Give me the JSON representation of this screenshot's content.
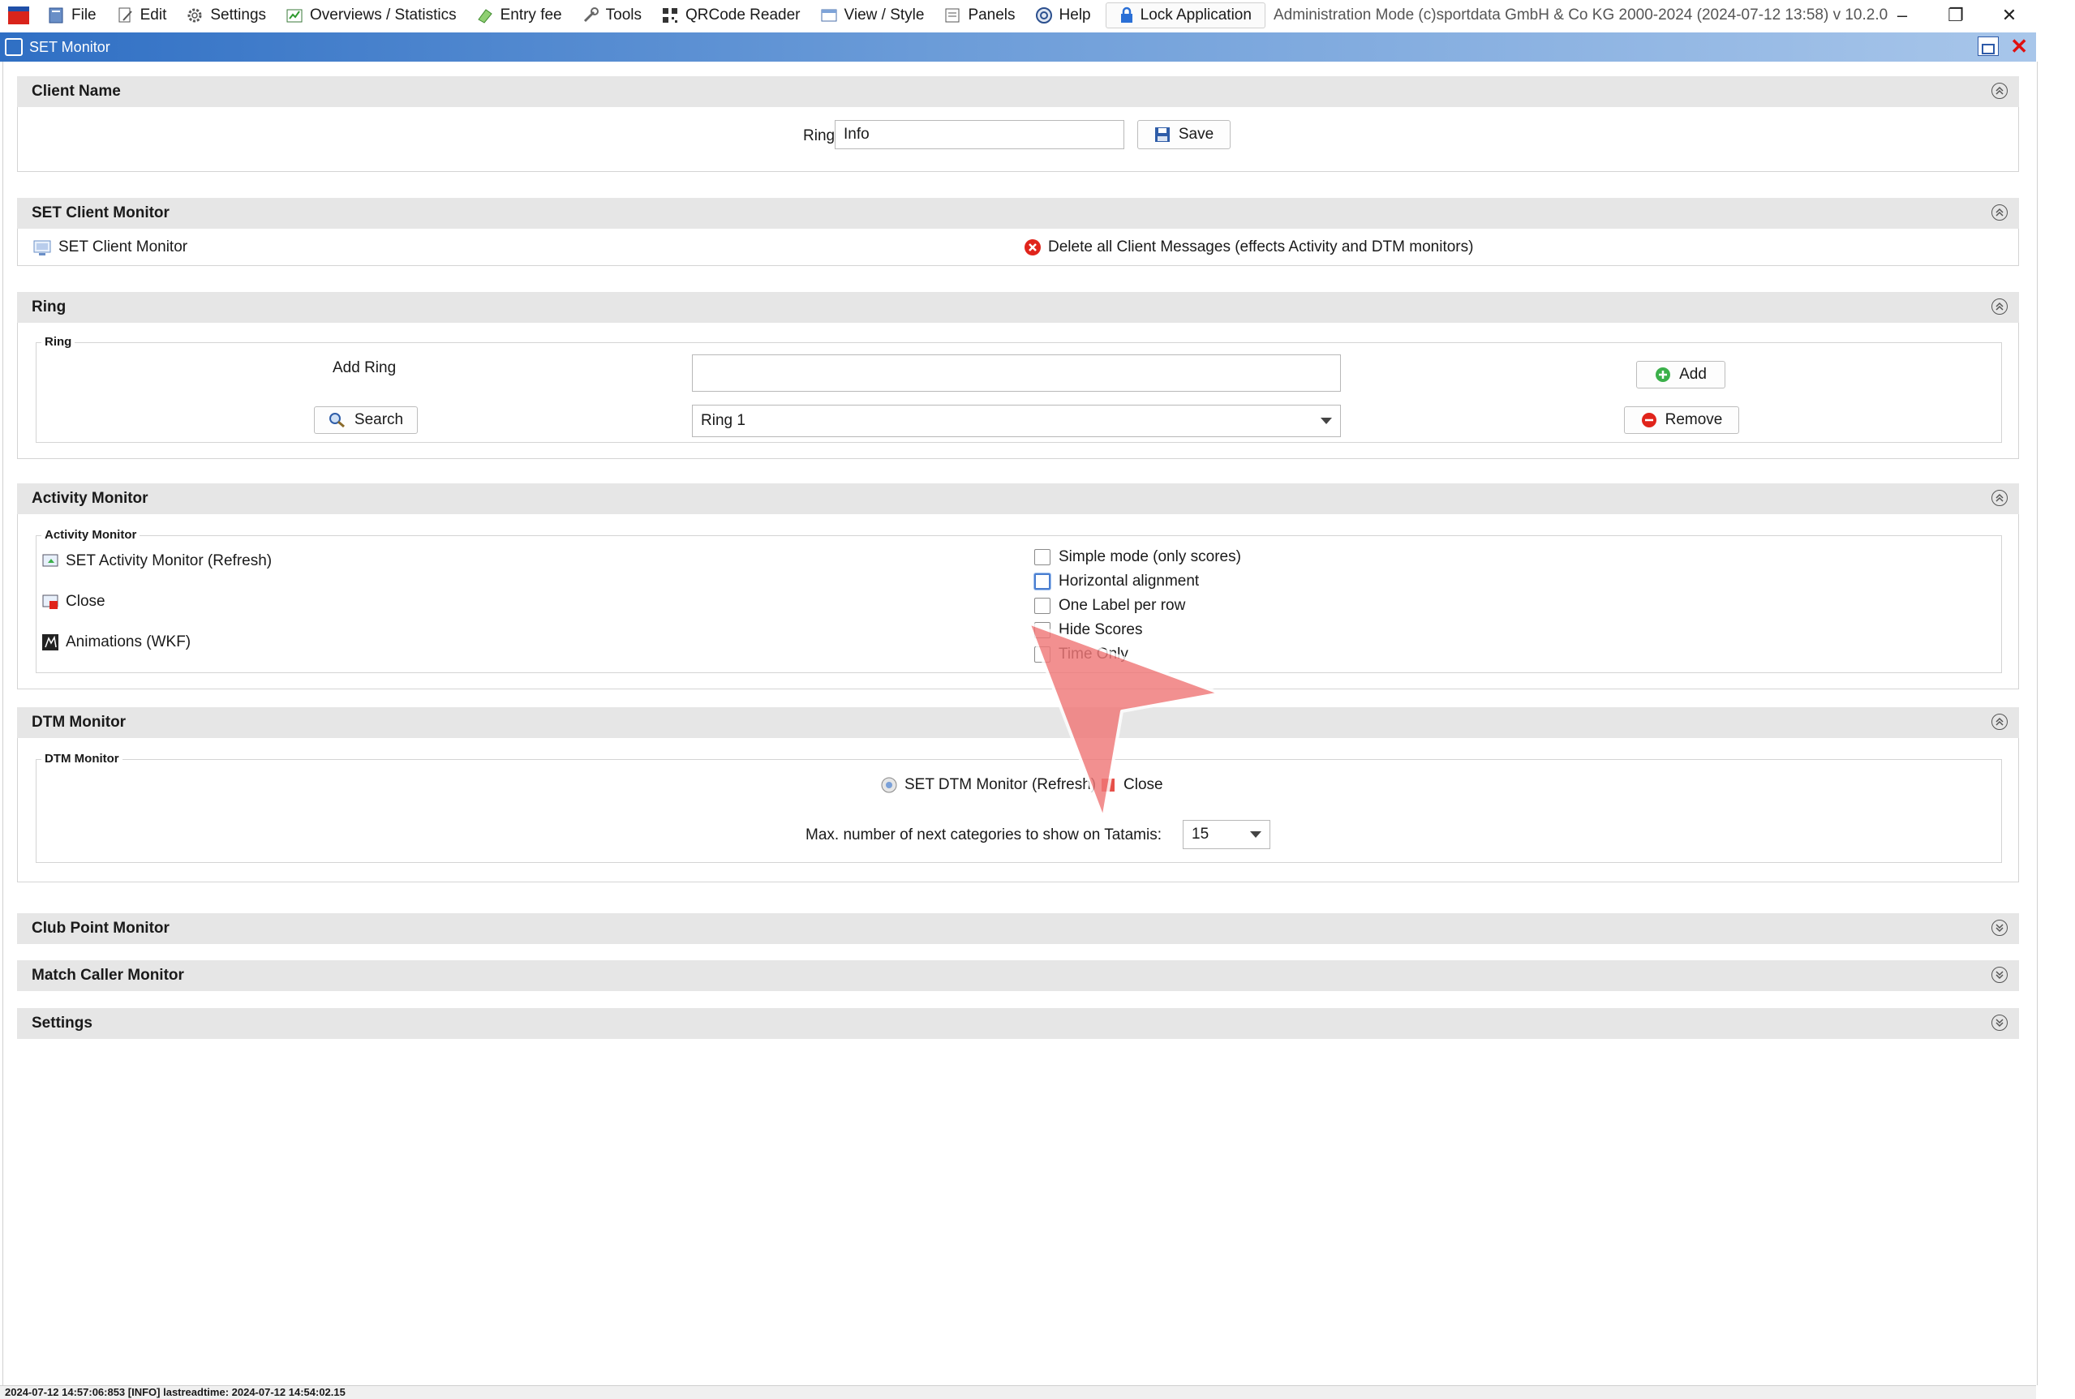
{
  "menu": {
    "file": "File",
    "edit": "Edit",
    "settings": "Settings",
    "overviews": "Overviews / Statistics",
    "entry_fee": "Entry fee",
    "tools": "Tools",
    "qrcode": "QRCode Reader",
    "view_style": "View / Style",
    "panels": "Panels",
    "help": "Help",
    "lock": "Lock Application",
    "title_info": "Administration Mode (c)sportdata GmbH & Co KG 2000-2024 (2024-07-12 13:58)  v 10.2.0 ..."
  },
  "window": {
    "title": "SET Monitor"
  },
  "client_name": {
    "header": "Client Name",
    "ring_label": "Ring",
    "ring_value": "Info",
    "save_label": "Save"
  },
  "set_client_monitor": {
    "header": "SET Client Monitor",
    "monitor_link": "SET Client Monitor",
    "delete_label": "Delete all Client Messages (effects Activity and DTM monitors)"
  },
  "ring": {
    "header": "Ring",
    "group_label": "Ring",
    "add_ring_label": "Add Ring",
    "add_ring_value": "",
    "add_label": "Add",
    "search_label": "Search",
    "ring_select": "Ring 1",
    "remove_label": "Remove"
  },
  "activity_monitor": {
    "header": "Activity Monitor",
    "group_label": "Activity Monitor",
    "refresh_label": "SET Activity Monitor (Refresh)",
    "close_label": "Close",
    "animations_label": "Animations (WKF)",
    "options": [
      {
        "label": "Simple mode (only scores)",
        "checked": false
      },
      {
        "label": "Horizontal alignment",
        "checked": false
      },
      {
        "label": "One Label per row",
        "checked": false
      },
      {
        "label": "Hide Scores",
        "checked": false
      },
      {
        "label": "Time Only",
        "checked": false
      }
    ]
  },
  "dtm_monitor": {
    "header": "DTM Monitor",
    "group_label": "DTM Monitor",
    "refresh_label": "SET DTM Monitor (Refresh)",
    "close_label": "Close",
    "max_label": "Max. number of next categories to show on Tatamis:",
    "max_value": "15"
  },
  "collapsed_panels": {
    "club_point": "Club Point Monitor",
    "match_caller": "Match Caller Monitor",
    "settings": "Settings"
  },
  "status": "2024-07-12 14:57:06:853 [INFO] lastreadtime: 2024-07-12 14:54:02.15",
  "colors": {
    "accent": "#2f6fc4",
    "danger": "#e0241b",
    "pointer": "#f07878"
  }
}
